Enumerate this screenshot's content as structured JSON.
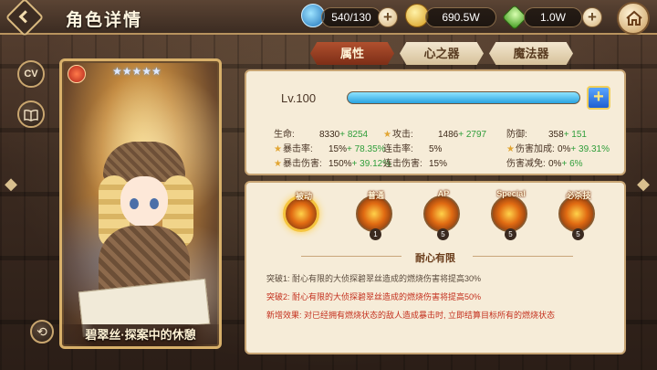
{
  "header": {
    "title": "角色详情",
    "stamina": "540/130",
    "gold": "690.5W",
    "gems": "1.0W"
  },
  "side": {
    "cv_label": "CV"
  },
  "card": {
    "name": "碧翠丝·探案中的休憩",
    "stars": "★★★★★",
    "star_count": 5
  },
  "tabs": [
    {
      "label": "属性",
      "active": true
    },
    {
      "label": "心之器",
      "active": false
    },
    {
      "label": "魔法器",
      "active": false
    }
  ],
  "stats": {
    "level": "Lv.100",
    "exp_fraction": 1.0,
    "rows": [
      [
        {
          "name": "生命:",
          "value": "8330",
          "bonus": "+ 8254",
          "star": false
        },
        {
          "name": "攻击:",
          "value": "1486",
          "bonus": "+ 2797",
          "star": true
        },
        {
          "name": "防御:",
          "value": "358",
          "bonus": "+ 151",
          "star": false
        }
      ],
      [
        {
          "name": "暴击率:",
          "value": "15%",
          "bonus": "+ 78.35%",
          "star": true
        },
        {
          "name": "连击率:",
          "value": "5%",
          "bonus": "",
          "star": false
        },
        {
          "name": "伤害加成:",
          "value": "0%",
          "bonus": "+ 39.31%",
          "star": true
        }
      ],
      [
        {
          "name": "暴击伤害:",
          "value": "150%",
          "bonus": "+ 39.12%",
          "star": true
        },
        {
          "name": "连击伤害:",
          "value": "15%",
          "bonus": "",
          "star": false
        },
        {
          "name": "伤害减免:",
          "value": "0%",
          "bonus": "+ 6%",
          "star": false
        }
      ]
    ]
  },
  "skills": {
    "items": [
      {
        "label": "被动",
        "level": ""
      },
      {
        "label": "普通",
        "level": "1"
      },
      {
        "label": "AP",
        "level": "5"
      },
      {
        "label": "Special",
        "level": "5"
      },
      {
        "label": "必杀技",
        "level": "5"
      }
    ],
    "selected_title": "耐心有限",
    "descriptions": [
      {
        "text": "突破1:  耐心有限的大侦探碧翠丝造成的燃烧伤害将提高30%",
        "style": "normal"
      },
      {
        "text": "突破2:  耐心有限的大侦探碧翠丝造成的燃烧伤害将提高50%",
        "style": "red"
      },
      {
        "text": "新增效果:  对已经拥有燃烧状态的敌人造成暴击时, 立即结算目标所有的燃烧状态",
        "style": "red"
      }
    ]
  }
}
